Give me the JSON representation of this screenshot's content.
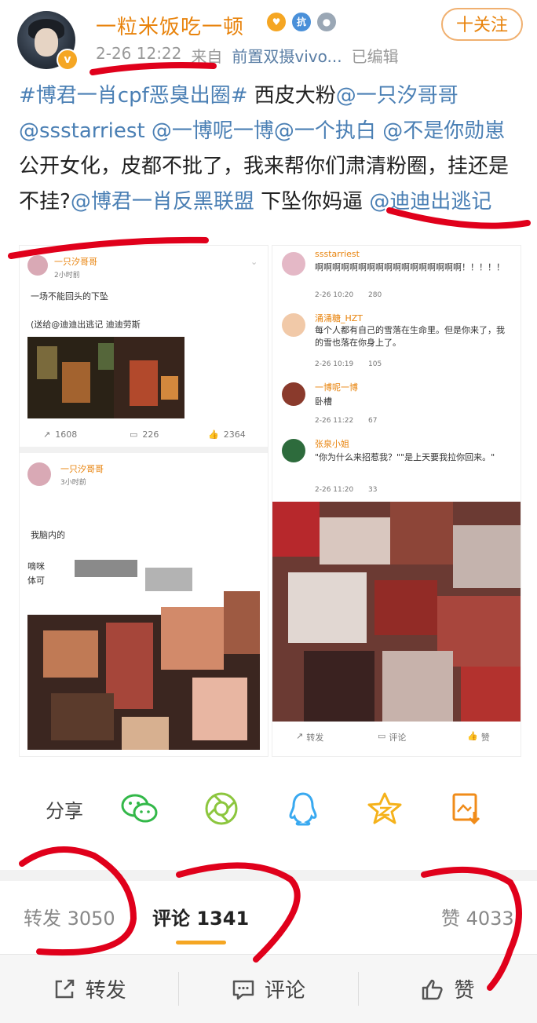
{
  "header": {
    "username": "一粒米饭吃一顿",
    "timestamp": "2-26 12:22",
    "source_prefix": "来自",
    "source": "前置双摄vivo...",
    "edited": "已编辑",
    "follow_label": "十关注",
    "badge_colors": [
      "#f5a623",
      "#4a90d9",
      "#9aa7b5"
    ]
  },
  "post": {
    "hashtag": "#博君一肖cpf恶臭出圈#",
    "t1": " 西皮大粉",
    "m1": "@一只汐哥哥",
    "m2": "@ssstarriest",
    "m3": " @一博呢一博",
    "m4": "@一个执白",
    "m5": " @不是你勋崽",
    "t2": " 公开女化，皮都不批了，我来帮你们肃清粉圈，挂还是不挂?",
    "m6": "@博君一肖反黑联盟",
    "t3": " 下坠你妈逼",
    "m7": "@迪迪出逃记"
  },
  "thumb_left": {
    "post1": {
      "name": "一只汐哥哥",
      "time": "2小时前",
      "line1": "一场不能回头的下坠",
      "line2": "(送给@迪迪出逃记 迪迪劳斯",
      "repost": "1608",
      "comment": "226",
      "like": "2364"
    },
    "post2": {
      "name": "一只汐哥哥",
      "time": "3小时前",
      "line1": "我脑内的",
      "line2": "嘀咪",
      "line3": "体可"
    }
  },
  "thumb_right": {
    "comments": [
      {
        "name": "ssstarriest",
        "text": "啊啊啊啊啊啊啊啊啊啊啊啊啊啊啊啊啊！！！！！",
        "time": "2-26 10:20",
        "likes": "280"
      },
      {
        "name": "涌涌糖_HZT",
        "text": "每个人都有自己的雪落在生命里。但是你来了，我的雪也落在你身上了。",
        "time": "2-26 10:19",
        "likes": "105"
      },
      {
        "name": "一博呢一博",
        "text": "卧槽",
        "time": "2-26 11:22",
        "likes": "67"
      },
      {
        "name": "张泉小姐",
        "text": "\"你为什么来招惹我？\"\"是上天要我拉你回来。\"",
        "time": "2-26 11:20",
        "likes": "33"
      }
    ],
    "footer": {
      "repost": "转发",
      "comment": "评论",
      "like": "赞"
    }
  },
  "share": {
    "label": "分享",
    "icons": [
      "wechat-icon",
      "moments-icon",
      "qq-icon",
      "qzone-icon",
      "save-image-icon"
    ]
  },
  "tabs": {
    "repost": "转发 3050",
    "comment": "评论 1341",
    "like": "赞 4033"
  },
  "bottom_bar": {
    "repost": "转发",
    "comment": "评论",
    "like": "赞"
  },
  "colors": {
    "accent": "#e8830c",
    "link": "#4a7fb4",
    "annotation": "#e0001b"
  }
}
